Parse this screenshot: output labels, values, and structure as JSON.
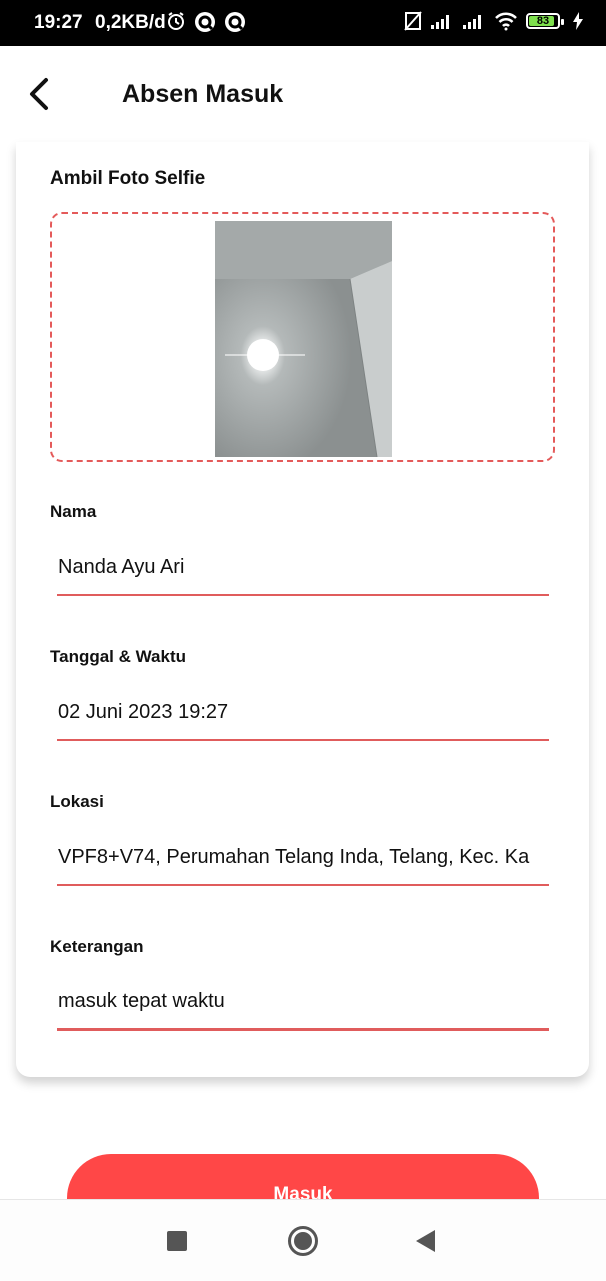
{
  "status_bar": {
    "time": "19:27",
    "network_speed": "0,2KB/d",
    "battery": "83",
    "icons": [
      "alarm-icon",
      "app-icon",
      "app-icon",
      "no-sim-icon",
      "signal-icon",
      "signal-icon",
      "wifi-icon",
      "battery-icon",
      "charging-icon"
    ]
  },
  "app_bar": {
    "title": "Absen Masuk"
  },
  "form": {
    "selfie_label": "Ambil Foto Selfie",
    "name_label": "Nama",
    "name_value": "Nanda Ayu Ari",
    "datetime_label": "Tanggal & Waktu",
    "datetime_value": "02 Juni 2023 19:27",
    "location_label": "Lokasi",
    "location_value": "VPF8+V74, Perumahan Telang Inda, Telang, Kec. Ka",
    "note_label": "Keterangan",
    "note_value": "masuk tepat waktu"
  },
  "submit_label": "Masuk",
  "colors": {
    "accent": "#ff4747",
    "dashed_border": "#e45a5a",
    "underline": "#e05c5c"
  },
  "nav_bar": {
    "icons": [
      "recents-icon",
      "home-icon",
      "back-icon"
    ]
  }
}
